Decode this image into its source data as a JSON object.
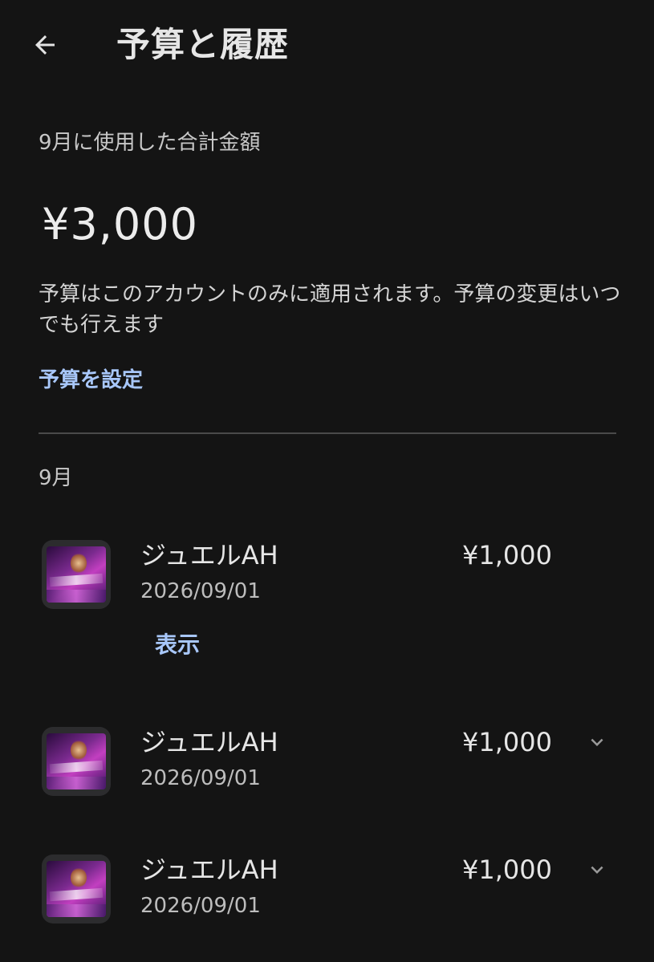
{
  "header": {
    "title": "予算と履歴",
    "back_icon": "arrow-back-icon"
  },
  "summary": {
    "total_label": "9月に使用した合計金額",
    "total_amount": "¥3,000",
    "budget_note": "予算はこのアカウントのみに適用されます。予算の変更はいつでも行えます",
    "set_budget_label": "予算を設定"
  },
  "history": {
    "month_label": "9月",
    "items": [
      {
        "name": "ジュエルAH",
        "date": "2026/09/01",
        "price": "¥1,000",
        "expanded": true,
        "view_label": "表示"
      },
      {
        "name": "ジュエルAH",
        "date": "2026/09/01",
        "price": "¥1,000",
        "expanded": false
      },
      {
        "name": "ジュエルAH",
        "date": "2026/09/01",
        "price": "¥1,000",
        "expanded": false
      }
    ]
  },
  "colors": {
    "background": "#141414",
    "accent": "#a8c7fa",
    "divider": "#4a4a4a"
  }
}
